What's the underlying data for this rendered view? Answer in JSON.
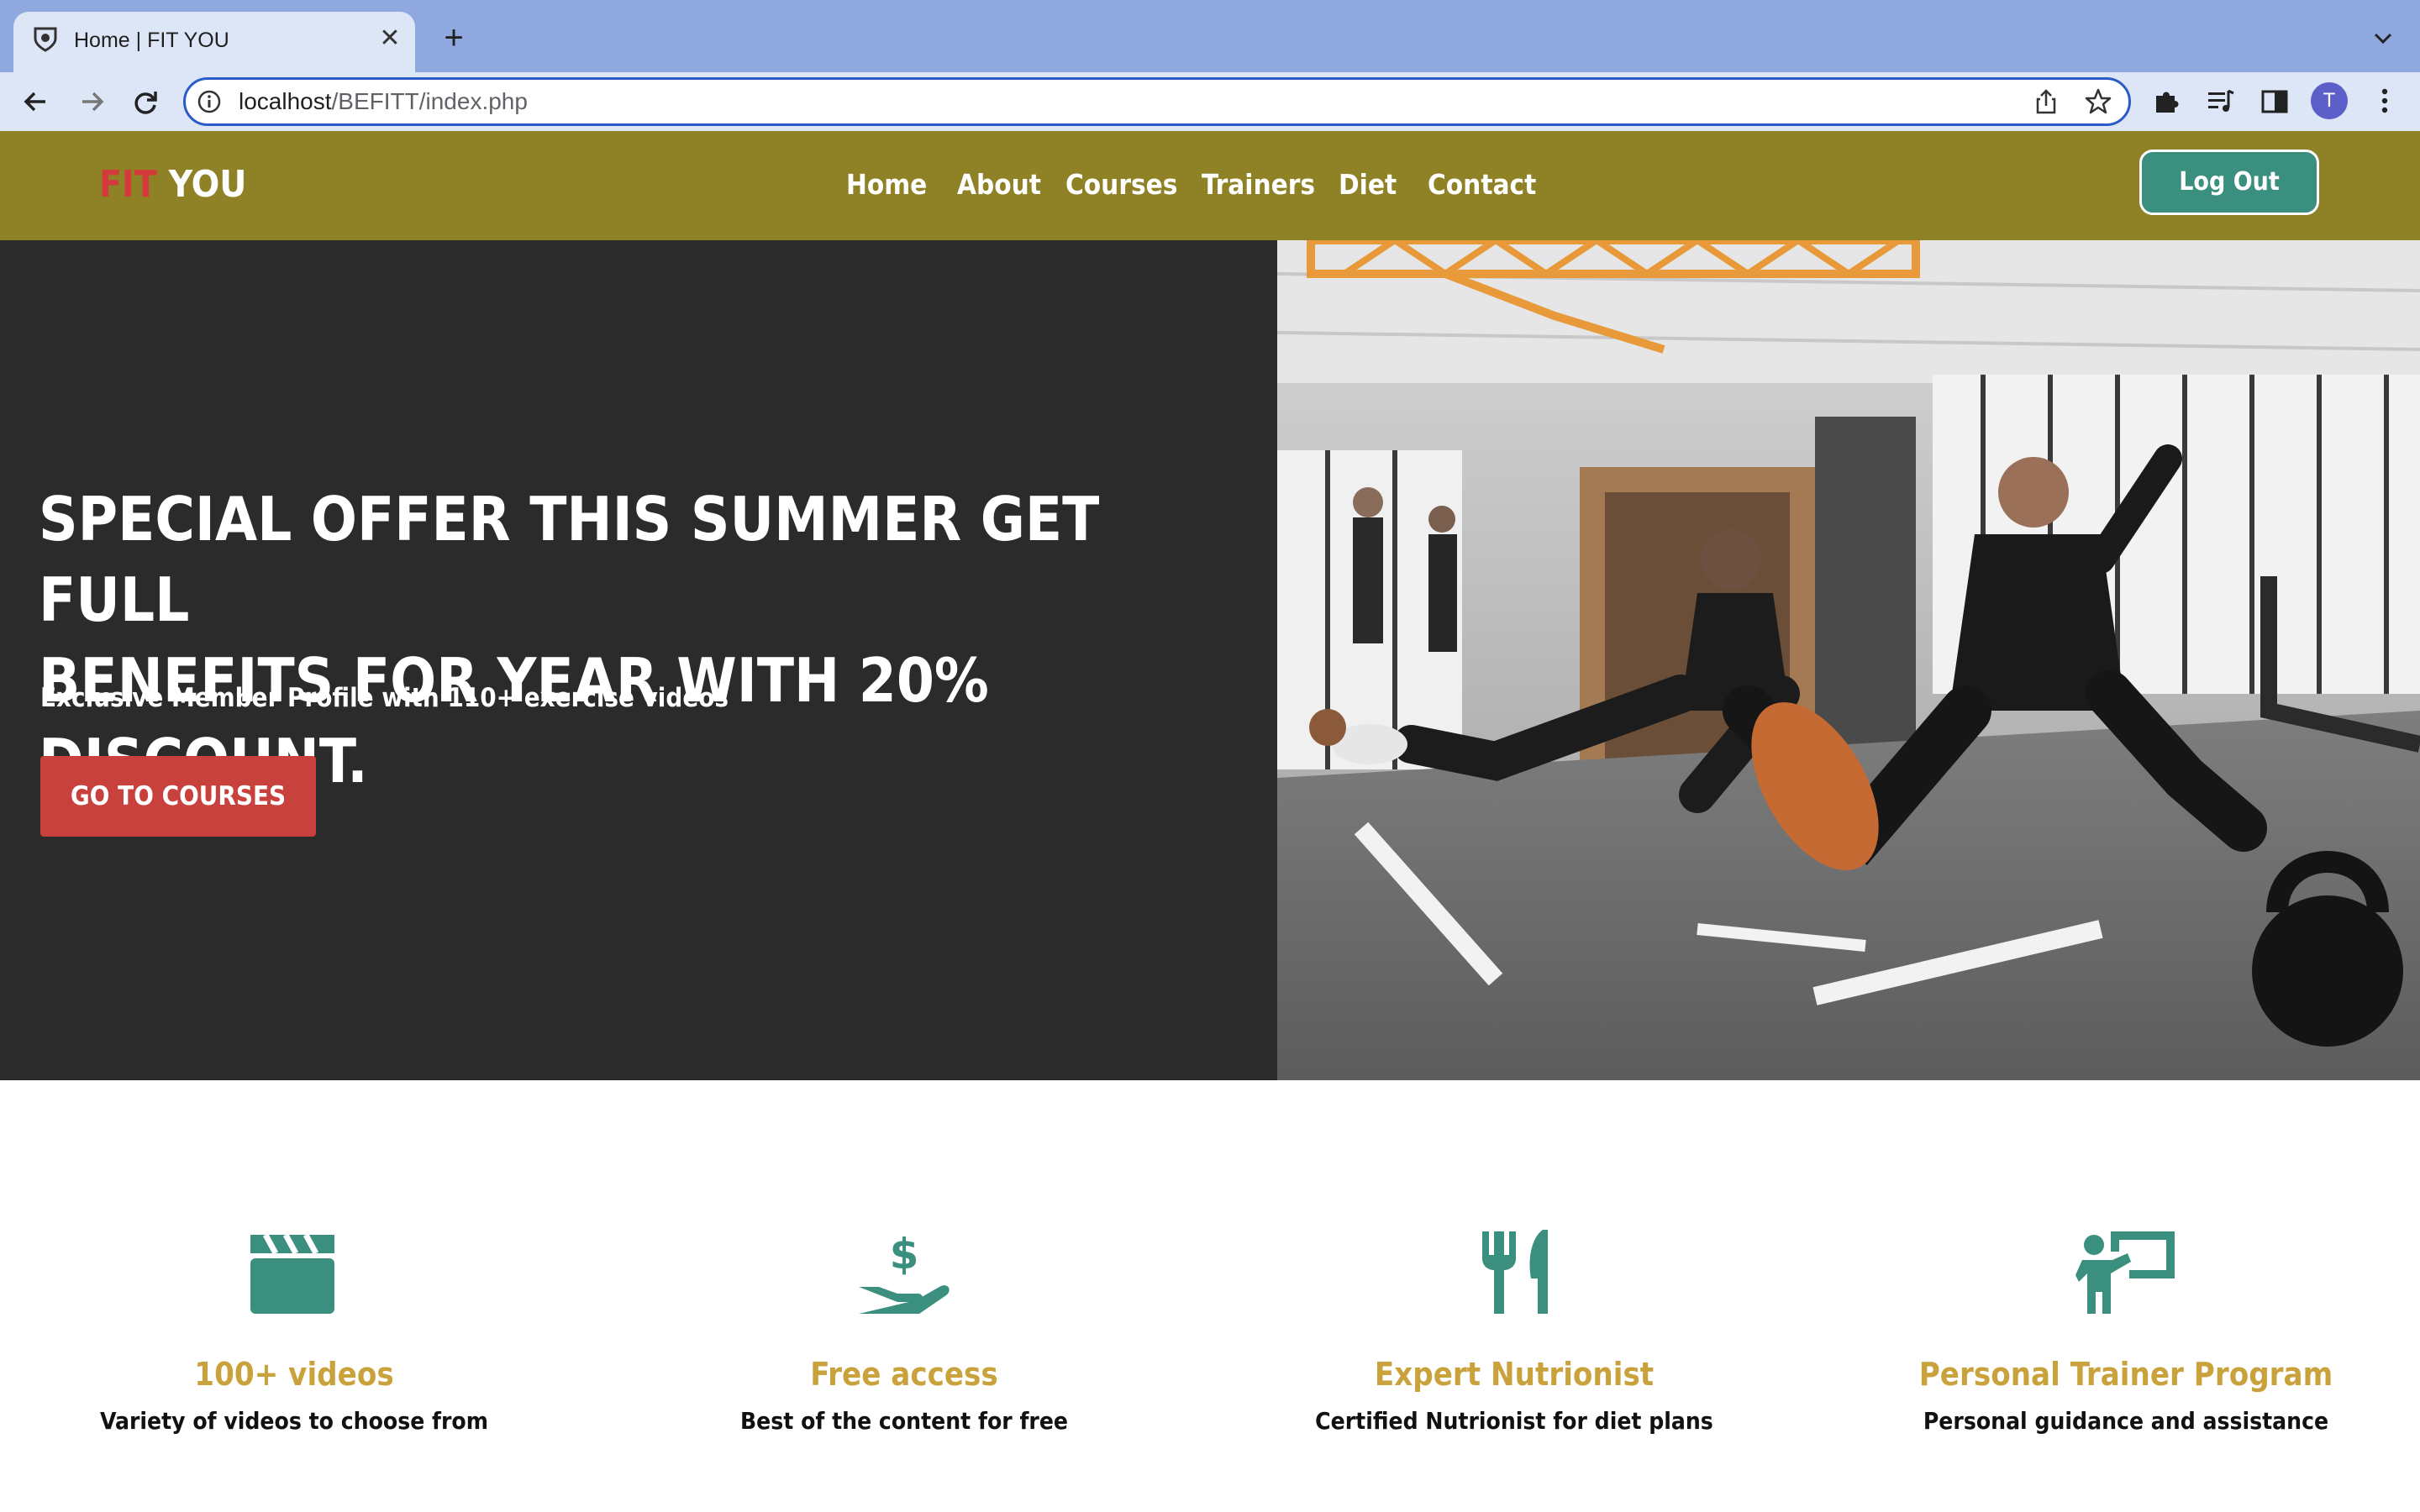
{
  "browser": {
    "tab_title": "Home | FIT YOU",
    "url_host": "localhost",
    "url_path": "/BEFITT/index.php",
    "profile_initial": "T",
    "close_glyph": "✕",
    "new_tab_glyph": "+",
    "icons": [
      "favicon-icon",
      "close-icon",
      "plus-icon",
      "chevron-down-icon",
      "back-arrow-icon",
      "forward-arrow-icon",
      "reload-icon",
      "info-icon",
      "share-icon",
      "star-icon",
      "puzzle-icon",
      "media-control-icon",
      "side-panel-icon",
      "kebab-menu-icon"
    ]
  },
  "navbar": {
    "logo_fit": "FIT",
    "logo_you": "YOU",
    "links": [
      "Home",
      "About",
      "Courses",
      "Trainers",
      "Diet",
      "Contact"
    ],
    "logout_label": "Log Out",
    "background": "#8f8125",
    "logout_color": "#3a8f7e"
  },
  "hero": {
    "heading_line1": "SPECIAL OFFER THIS SUMMER GET FULL",
    "heading_line2": "BENEFITS FOR YEAR WITH 20% DISCOUNT.",
    "subtext": "Exclusive Member Profile with 110+ exercise videos",
    "cta_label": "GO TO COURSES",
    "cta_color": "#c9413d",
    "image_subject": "gym workout photo"
  },
  "features": [
    {
      "icon": "clapperboard-icon",
      "title": "100+ videos",
      "desc": "Variety of videos to choose from"
    },
    {
      "icon": "hand-dollar-icon",
      "title": "Free access",
      "desc": "Best of the content for free"
    },
    {
      "icon": "fork-knife-icon",
      "title": "Expert Nutrionist",
      "desc": "Certified Nutrionist for diet plans"
    },
    {
      "icon": "trainer-board-icon",
      "title": "Personal Trainer Program",
      "desc": "Personal guidance and assistance"
    }
  ],
  "colors": {
    "feature_icon": "#3a8f7e",
    "feature_title": "#c9a23c"
  }
}
